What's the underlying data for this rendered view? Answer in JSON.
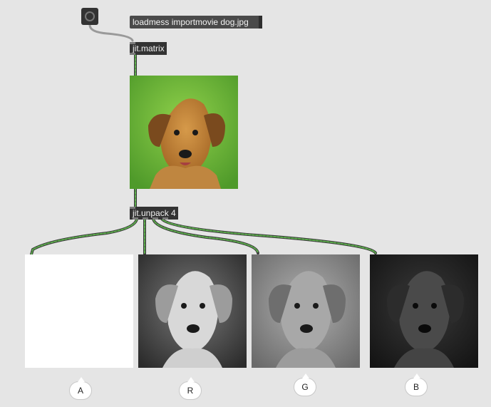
{
  "patcher": {
    "bang": {
      "icon": "bang-icon"
    },
    "message": {
      "label": "loadmess importmovie dog.jpg"
    },
    "matrix": {
      "label": "jit.matrix"
    },
    "unpack": {
      "label": "jit.unpack 4"
    },
    "planes": [
      {
        "label": "A",
        "level": 1.0
      },
      {
        "label": "R",
        "level": 0.72
      },
      {
        "label": "G",
        "level": 0.58
      },
      {
        "label": "B",
        "level": 0.28
      }
    ]
  },
  "colors": {
    "background": "#e5e5e5",
    "object": "#333333",
    "matrix_wire": "#3f8f3f",
    "control_wire": "#9a9a9a",
    "preview_bg": "#6fb83a",
    "dog_fur": "#c68a3a"
  }
}
